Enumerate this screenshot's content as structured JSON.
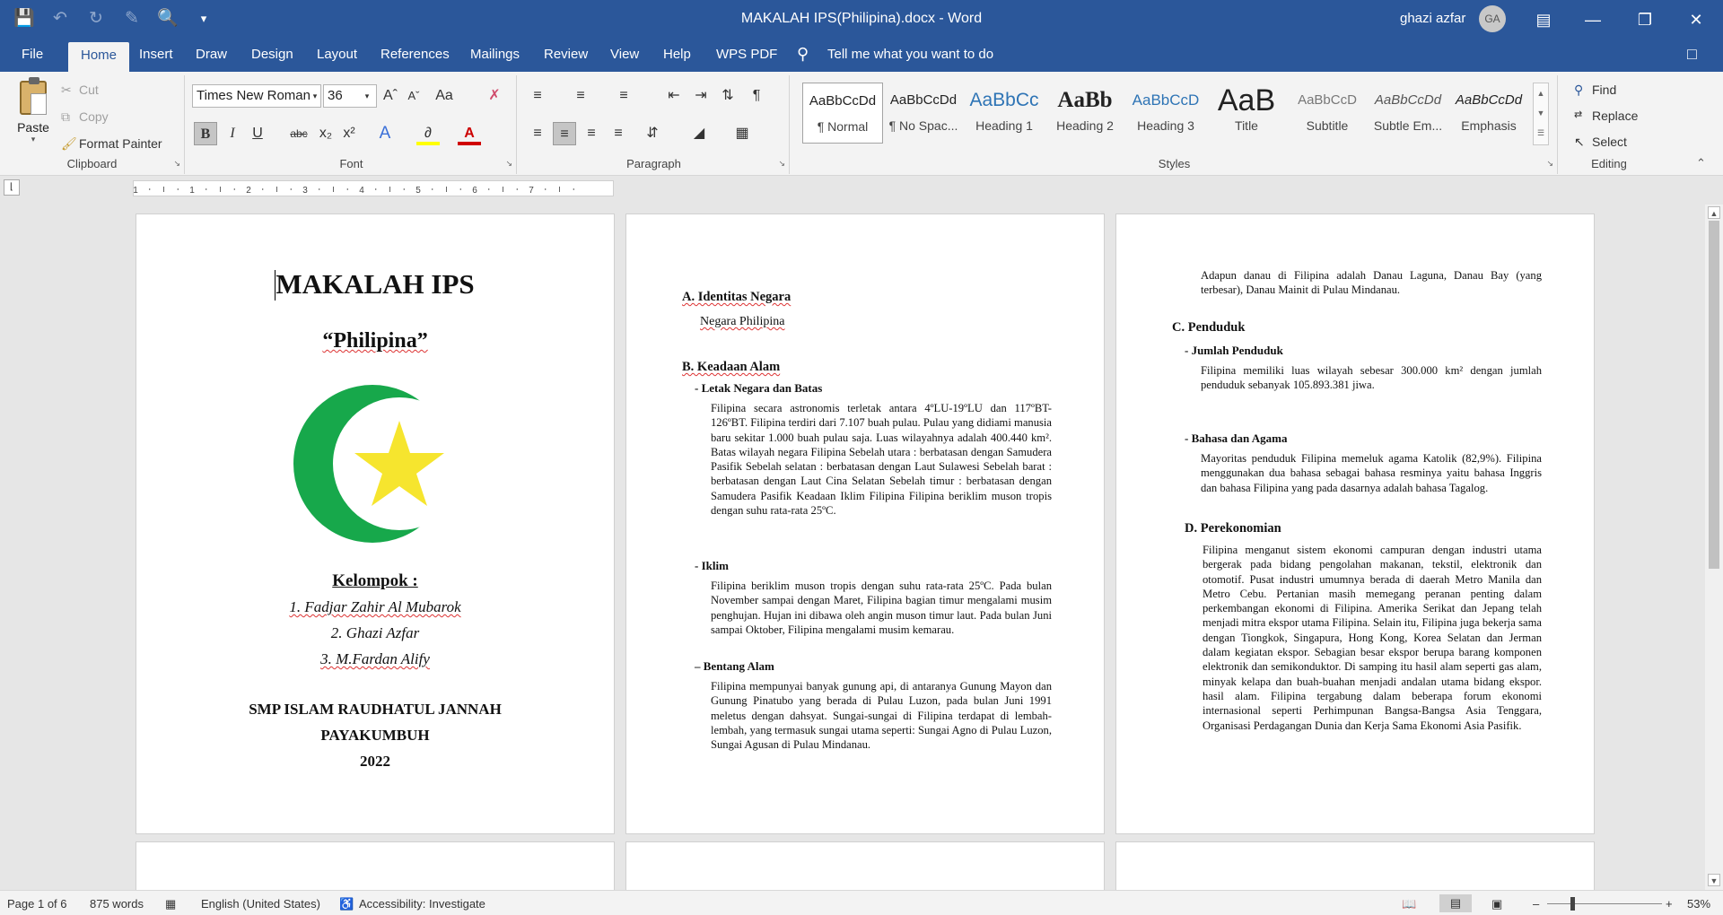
{
  "window": {
    "title": "MAKALAH IPS(Philipina).docx  -  Word",
    "user_name": "ghazi azfar",
    "user_initials": "GA"
  },
  "quick_access": {
    "icons": [
      "save-icon",
      "undo-icon",
      "redo-icon",
      "draw-icon",
      "print-preview-icon",
      "customize-icon"
    ]
  },
  "tabs": [
    {
      "label": "File"
    },
    {
      "label": "Home",
      "active": true
    },
    {
      "label": "Insert"
    },
    {
      "label": "Draw"
    },
    {
      "label": "Design"
    },
    {
      "label": "Layout"
    },
    {
      "label": "References"
    },
    {
      "label": "Mailings"
    },
    {
      "label": "Review"
    },
    {
      "label": "View"
    },
    {
      "label": "Help"
    },
    {
      "label": "WPS PDF"
    }
  ],
  "tell_me": "Tell me what you want to do",
  "ribbon": {
    "clipboard": {
      "label": "Clipboard",
      "paste": "Paste",
      "cut": "Cut",
      "copy": "Copy",
      "format_painter": "Format Painter"
    },
    "font": {
      "label": "Font",
      "font_name": "Times New Roman",
      "font_size": "36",
      "bold": "B",
      "italic": "I",
      "underline": "U",
      "strike": "abc",
      "subscript": "x₂",
      "superscript": "x²"
    },
    "paragraph": {
      "label": "Paragraph"
    },
    "styles": {
      "label": "Styles",
      "items": [
        {
          "sample": "AaBbCcDd",
          "name": "¶ Normal"
        },
        {
          "sample": "AaBbCcDd",
          "name": "¶ No Spac..."
        },
        {
          "sample": "AaBbCc",
          "name": "Heading 1"
        },
        {
          "sample": "AaBb",
          "name": "Heading 2"
        },
        {
          "sample": "AaBbCcD",
          "name": "Heading 3"
        },
        {
          "sample": "AaB",
          "name": "Title"
        },
        {
          "sample": "AaBbCcD",
          "name": "Subtitle"
        },
        {
          "sample": "AaBbCcDd",
          "name": "Subtle Em..."
        },
        {
          "sample": "AaBbCcDd",
          "name": "Emphasis"
        }
      ]
    },
    "editing": {
      "label": "Editing",
      "find": "Find",
      "replace": "Replace",
      "select": "Select"
    }
  },
  "ruler": {
    "numbers": [
      "1",
      "1",
      "2",
      "3",
      "4",
      "5",
      "6",
      "7"
    ]
  },
  "pages": {
    "cover": {
      "title": "MAKALAH IPS",
      "subtitle": "“Philipina”",
      "group_label": "Kelompok :",
      "members": [
        "1. Fadjar Zahir Al Mubarok",
        "2. Ghazi Azfar",
        "3. M.Fardan Alify"
      ],
      "school": [
        "SMP ISLAM RAUDHATUL JANNAH",
        "PAYAKUMBUH",
        "2022"
      ]
    },
    "page2": {
      "a_heading": "A. Identitas Negara",
      "a_text": "Negara Philipina",
      "b_heading": "B. Keadaan Alam",
      "b1_heading": "-   Letak Negara dan Batas",
      "b1_text": "Filipina secara astronomis terletak antara 4ºLU-19ºLU dan 117ºBT-126ºBT. Filipina terdiri dari 7.107 buah pulau. Pulau yang didiami manusia baru sekitar 1.000 buah pulau saja. Luas wilayahnya adalah 400.440 km². Batas wilayah negara Filipina Sebelah utara : berbatasan dengan Samudera Pasifik Sebelah selatan : berbatasan dengan Laut Sulawesi Sebelah barat : berbatasan dengan Laut Cina Selatan Sebelah timur : berbatasan dengan Samudera Pasifik Keadaan Iklim Filipina Filipina beriklim muson tropis dengan suhu rata-rata 25ºC.",
      "b2_heading": "-   Iklim",
      "b2_text": "Filipina beriklim muson tropis dengan suhu rata-rata 25ºC. Pada bulan November sampai dengan Maret, Filipina bagian timur mengalami musim penghujan. Hujan ini dibawa oleh angin muson timur laut. Pada bulan Juni sampai Oktober, Filipina mengalami musim kemarau.",
      "b3_heading": "–   Bentang Alam",
      "b3_text": "Filipina mempunyai banyak gunung api, di antaranya Gunung Mayon dan Gunung Pinatubo yang berada di Pulau Luzon, pada bulan Juni 1991 meletus dengan dahsyat. Sungai-sungai di Filipina terdapat di lembah-lembah, yang termasuk sungai utama seperti: Sungai Agno di Pulau Luzon, Sungai Agusan di Pulau Mindanau."
    },
    "page3": {
      "lakes_text": "Adapun danau di Filipina adalah Danau Laguna, Danau Bay (yang terbesar), Danau Mainit di Pulau Mindanau.",
      "c_heading": "C. Penduduk",
      "c1_heading": "-   Jumlah Penduduk",
      "c1_text": "Filipina memiliki luas wilayah sebesar 300.000 km² dengan jumlah penduduk sebanyak 105.893.381 jiwa.",
      "c2_heading": "-   Bahasa dan Agama",
      "c2_text": "Mayoritas penduduk Filipina memeluk agama Katolik (82,9%). Filipina menggunakan dua bahasa sebagai bahasa resminya yaitu bahasa Inggris dan bahasa Filipina yang pada dasarnya adalah bahasa Tagalog.",
      "d_heading": "D. Perekonomian",
      "d_text": "Filipina menganut sistem ekonomi campuran dengan industri utama bergerak pada bidang pengolahan makanan, tekstil, elektronik dan otomotif. Pusat industri umumnya berada di daerah Metro Manila dan Metro Cebu. Pertanian masih memegang peranan penting dalam perkembangan ekonomi di Filipina. Amerika Serikat dan Jepang telah menjadi mitra ekspor utama Filipina. Selain itu, Filipina juga bekerja sama dengan Tiongkok, Singapura, Hong Kong, Korea Selatan dan Jerman dalam kegiatan ekspor. Sebagian besar ekspor berupa barang komponen elektronik dan semikonduktor. Di samping itu hasil alam seperti gas alam, minyak kelapa dan buah-buahan menjadi andalan utama bidang ekspor. hasil alam. Filipina tergabung dalam beberapa forum ekonomi internasional seperti Perhimpunan Bangsa-Bangsa Asia Tenggara, Organisasi Perdagangan Dunia dan Kerja Sama Ekonomi Asia Pasifik."
    }
  },
  "status": {
    "page": "Page 1 of 6",
    "words": "875 words",
    "language": "English (United States)",
    "accessibility": "Accessibility: Investigate",
    "zoom": "53%"
  },
  "colors": {
    "brand": "#2b579a",
    "logo_green": "#17a84b",
    "logo_yellow": "#f6e52e"
  }
}
